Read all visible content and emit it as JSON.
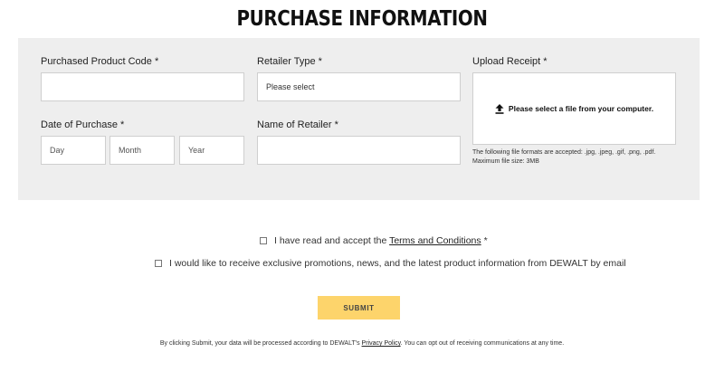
{
  "page_title": "PURCHASE INFORMATION",
  "form": {
    "product_code_label": "Purchased Product Code *",
    "retailer_type_label": "Retailer Type *",
    "retailer_type_value": "Please select",
    "upload_label": "Upload Receipt *",
    "upload_prompt": "Please select a file from your computer.",
    "upload_formats": "The following file formats are accepted: .jpg, .jpeg, .gif, .png, .pdf.",
    "upload_max_size": "Maximum file size: 3MB",
    "date_label": "Date of Purchase *",
    "day_placeholder": "Day",
    "month_placeholder": "Month",
    "year_placeholder": "Year",
    "retailer_name_label": "Name of Retailer *"
  },
  "consent": {
    "terms_prefix": "I have read and accept the",
    "terms_link": "Terms and Conditions",
    "terms_suffix": "*",
    "promo_text": "I would like to receive exclusive promotions, news, and the latest product information from DEWALT by email"
  },
  "submit_label": "SUBMIT",
  "footer": {
    "prefix": "By clicking Submit, your data will be processed according to DEWALT's",
    "privacy_link": "Privacy Policy",
    "suffix": ". You can opt out of receiving communications at any time."
  },
  "colors": {
    "panel_bg": "#eeeeee",
    "submit_bg": "#fdd46b"
  }
}
